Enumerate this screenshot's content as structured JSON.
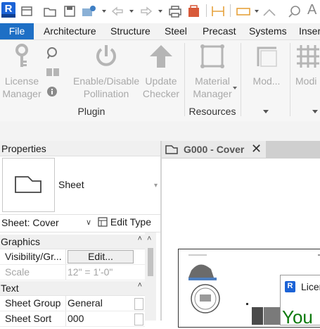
{
  "app": {
    "logo_letter": "R"
  },
  "quick_access": {
    "icons": [
      "open-icon",
      "save-icon",
      "sync-icon",
      "undo-icon",
      "redo-icon",
      "print-icon",
      "measure-icon",
      "dimension-icon",
      "tag-icon",
      "text-icon"
    ]
  },
  "ribbon_tabs": [
    "File",
    "Architecture",
    "Structure",
    "Steel",
    "Precast",
    "Systems",
    "Inser"
  ],
  "ribbon": {
    "plugin": {
      "license_label_1": "License",
      "license_label_2": "Manager",
      "enable_label_1": "Enable/Disable",
      "enable_label_2": "Pollination",
      "update_label_1": "Update",
      "update_label_2": "Checker",
      "title": "Plugin"
    },
    "resources": {
      "material_label_1": "Material",
      "material_label_2": "Manager",
      "title": "Resources"
    },
    "mod1": "Mod...",
    "mod2": "Modi"
  },
  "properties": {
    "title": "Properties",
    "type_name": "Sheet",
    "type_selector": "Sheet: Cover",
    "edit_type": "Edit Type",
    "categories": {
      "graphics": "Graphics",
      "text": "Text"
    },
    "rows": {
      "visibility_name": "Visibility/Gr...",
      "visibility_value": "Edit...",
      "scale_name": "Scale",
      "scale_value": "12\" = 1'-0\"",
      "sheet_group_name": "Sheet Group",
      "sheet_group_value": "General",
      "sheet_sort_name": "Sheet Sort",
      "sheet_sort_value": "000"
    }
  },
  "view": {
    "tab_title": "G000 - Cover"
  },
  "dialog": {
    "title": "Licer",
    "big_text": "You"
  },
  "colors": {
    "file_tab": "#1e6fc5",
    "revit_blue": "#1c63d6",
    "dialog_green": "#0e7a0e"
  }
}
